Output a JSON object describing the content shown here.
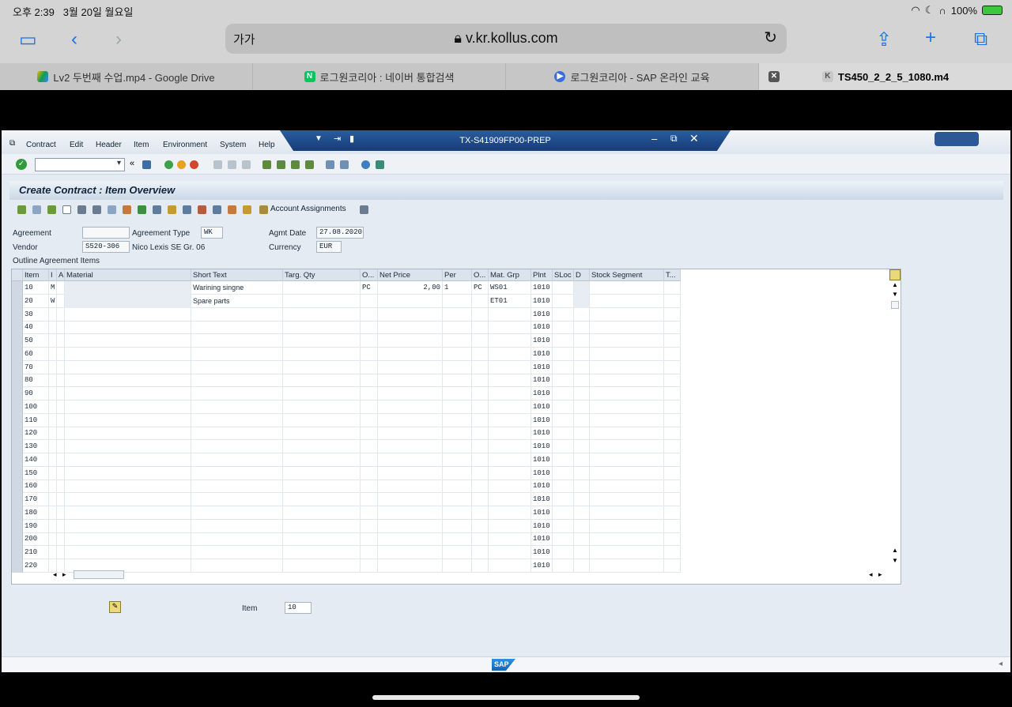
{
  "status": {
    "time": "오후 2:39",
    "date": "3월 20일 월요일",
    "battery": "100%"
  },
  "browser": {
    "text_size": "가가",
    "url": "v.kr.kollus.com",
    "tabs": [
      {
        "label": "Lv2 두번째 수업.mp4 - Google Drive",
        "icon": "google-drive-icon"
      },
      {
        "label": "로그원코리아 : 네이버 통합검색",
        "icon": "naver-icon"
      },
      {
        "label": "로그원코리아 - SAP 온라인 교육",
        "icon": "play-icon"
      },
      {
        "label": "TS450_2_2_5_1080.m4",
        "icon": "k-icon",
        "active": true
      }
    ]
  },
  "sap": {
    "menu": [
      "Contract",
      "Edit",
      "Header",
      "Item",
      "Environment",
      "System",
      "Help"
    ],
    "system_title": "TX-S41909FP00-PREP",
    "page_title": "Create Contract : Item Overview",
    "account_assignments": "Account Assignments",
    "header_fields": {
      "agreement_label": "Agreement",
      "agreement_value": "",
      "agreement_type_label": "Agreement Type",
      "agreement_type_value": "WK",
      "agmt_date_label": "Agmt Date",
      "agmt_date_value": "27.08.2020",
      "vendor_label": "Vendor",
      "vendor_value": "S520-306",
      "vendor_name": "Nico Lexis SE Gr. 06",
      "currency_label": "Currency",
      "currency_value": "EUR"
    },
    "section_title": "Outline Agreement Items",
    "columns": [
      "Item",
      "I",
      "A",
      "Material",
      "Short Text",
      "Targ. Qty",
      "O...",
      "Net Price",
      "Per",
      "O...",
      "Mat. Grp",
      "Plnt",
      "SLoc",
      "D",
      "Stock Segment",
      "T..."
    ],
    "rows": [
      {
        "item": "10",
        "i": "M",
        "short_text": "Warining singne",
        "o1": "PC",
        "net_price": "2,00",
        "per": "1",
        "o2": "PC",
        "mat_grp": "WS01",
        "plnt": "1010"
      },
      {
        "item": "20",
        "i": "W",
        "short_text": "Spare parts",
        "o1": "",
        "net_price": "",
        "per": "",
        "o2": "",
        "mat_grp": "ET01",
        "plnt": "1010"
      },
      {
        "item": "30",
        "plnt": "1010"
      },
      {
        "item": "40",
        "plnt": "1010"
      },
      {
        "item": "50",
        "plnt": "1010"
      },
      {
        "item": "60",
        "plnt": "1010"
      },
      {
        "item": "70",
        "plnt": "1010"
      },
      {
        "item": "80",
        "plnt": "1010"
      },
      {
        "item": "90",
        "plnt": "1010"
      },
      {
        "item": "100",
        "plnt": "1010"
      },
      {
        "item": "110",
        "plnt": "1010"
      },
      {
        "item": "120",
        "plnt": "1010"
      },
      {
        "item": "130",
        "plnt": "1010"
      },
      {
        "item": "140",
        "plnt": "1010"
      },
      {
        "item": "150",
        "plnt": "1010"
      },
      {
        "item": "160",
        "plnt": "1010"
      },
      {
        "item": "170",
        "plnt": "1010"
      },
      {
        "item": "180",
        "plnt": "1010"
      },
      {
        "item": "190",
        "plnt": "1010"
      },
      {
        "item": "200",
        "plnt": "1010"
      },
      {
        "item": "210",
        "plnt": "1010"
      },
      {
        "item": "220",
        "plnt": "1010"
      }
    ],
    "item_label": "Item",
    "item_value": "10",
    "logo": "SAP"
  }
}
